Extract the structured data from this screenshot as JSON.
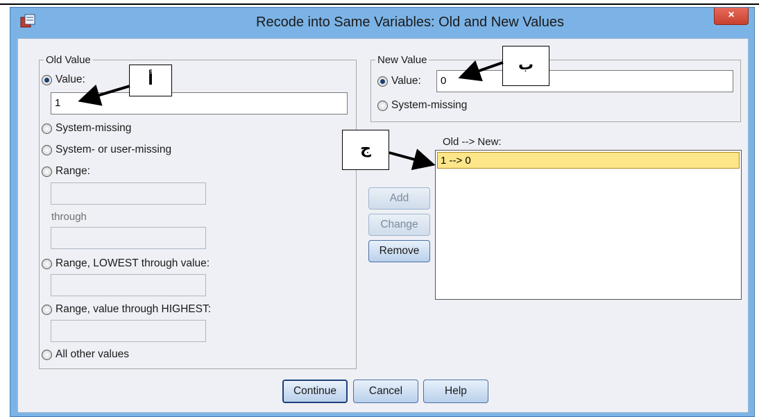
{
  "window": {
    "title": "Recode into Same Variables: Old and New Values",
    "close_label": "×"
  },
  "old_value": {
    "legend": "Old Value",
    "value_label": "Value:",
    "value_input": "1",
    "system_missing": "System-missing",
    "system_user_missing": "System- or user-missing",
    "range_label": "Range:",
    "through_label": "through",
    "range_lowest": "Range, LOWEST through value:",
    "range_highest": "Range, value through HIGHEST:",
    "all_other": "All other values",
    "selected": "value"
  },
  "new_value": {
    "legend": "New Value",
    "value_label": "Value:",
    "value_input": "0",
    "system_missing": "System-missing",
    "selected": "value"
  },
  "mapping": {
    "header": "Old --> New:",
    "items": [
      "1 --> 0"
    ]
  },
  "buttons": {
    "add": "Add",
    "change": "Change",
    "remove": "Remove",
    "continue": "Continue",
    "cancel": "Cancel",
    "help": "Help"
  },
  "annotations": {
    "a": "أ",
    "b": "ب",
    "c": "ج"
  }
}
